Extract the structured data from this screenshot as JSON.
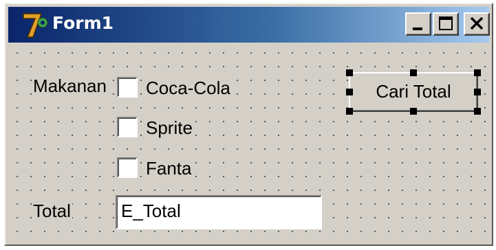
{
  "window": {
    "title": "Form1",
    "icon": "app-7-icon",
    "controls": [
      "minimize-icon",
      "maximize-icon",
      "close-icon"
    ]
  },
  "form": {
    "makanan_label": "Makanan",
    "total_label": "Total",
    "checkboxes": [
      {
        "label": "Coca-Cola",
        "checked": false
      },
      {
        "label": "Sprite",
        "checked": false
      },
      {
        "label": "Fanta",
        "checked": false
      }
    ],
    "total_field": {
      "value": "E_Total"
    },
    "cari_total_button": {
      "label": "Cari Total",
      "selected": true
    }
  },
  "colors": {
    "face": "#d4d0c8",
    "title_start": "#0a246a",
    "title_end": "#a6caf0"
  }
}
